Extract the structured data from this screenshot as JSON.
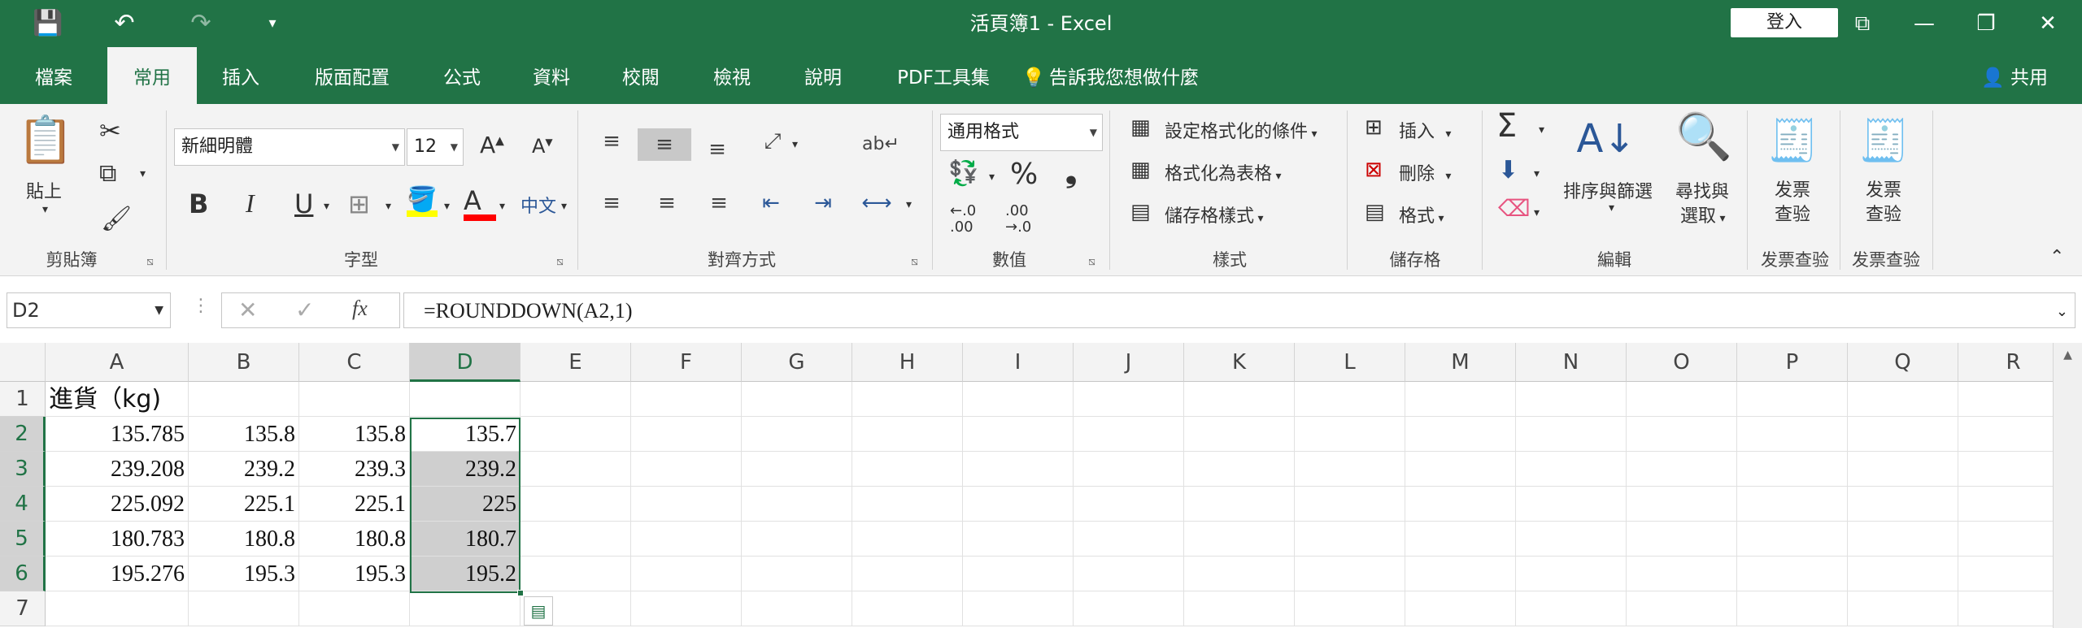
{
  "window": {
    "title": "活頁簿1  -  Excel",
    "login_label": "登入",
    "icons": {
      "save": "💾",
      "undo": "↶",
      "redo": "↷",
      "customize": "▾",
      "restore": "⧉",
      "minimize": "—",
      "maximize": "❐",
      "close": "✕"
    }
  },
  "tabs": [
    {
      "label": "檔案"
    },
    {
      "label": "常用"
    },
    {
      "label": "插入"
    },
    {
      "label": "版面配置"
    },
    {
      "label": "公式"
    },
    {
      "label": "資料"
    },
    {
      "label": "校閱"
    },
    {
      "label": "檢視"
    },
    {
      "label": "說明"
    },
    {
      "label": "PDF工具集"
    },
    {
      "label": "告訴我您想做什麼"
    }
  ],
  "active_tab": "常用",
  "share_label": "共用",
  "ribbon": {
    "clipboard": {
      "paste": "貼上",
      "group": "剪貼簿"
    },
    "font": {
      "name": "新細明體",
      "size": "12",
      "group": "字型",
      "bold": "B",
      "italic": "I",
      "underline": "U",
      "phonetic": "中文"
    },
    "alignment": {
      "group": "對齊方式"
    },
    "number": {
      "format": "通用格式",
      "percent": "%",
      "comma": "❟",
      "inc_decimal": "←.0\n.00",
      "dec_decimal": ".00\n→.0",
      "group": "數值"
    },
    "styles": {
      "conditional": "設定格式化的條件",
      "as_table": "格式化為表格",
      "cell_styles": "儲存格樣式",
      "group": "樣式"
    },
    "cells": {
      "insert": "插入",
      "delete": "刪除",
      "format": "格式",
      "group": "儲存格"
    },
    "editing": {
      "sort_filter": "排序與篩選",
      "find_select_1": "尋找與",
      "find_select_2": "選取",
      "group": "編輯"
    },
    "invoice1": {
      "label_1": "发票",
      "label_2": "查验",
      "group": "发票查验"
    },
    "invoice2": {
      "label_1": "发票",
      "label_2": "查验",
      "group": "发票查验"
    }
  },
  "formula_bar": {
    "name_box": "D2",
    "formula": "=ROUNDDOWN(A2,1)",
    "fx": "fx"
  },
  "columns": [
    "A",
    "B",
    "C",
    "D",
    "E",
    "F",
    "G",
    "H",
    "I",
    "J",
    "K",
    "L",
    "M",
    "N",
    "O",
    "P",
    "Q",
    "R"
  ],
  "rows": [
    "1",
    "2",
    "3",
    "4",
    "5",
    "6",
    "7"
  ],
  "cells": {
    "A1": "進貨（kg)",
    "A": [
      "135.785",
      "239.208",
      "225.092",
      "180.783",
      "195.276"
    ],
    "B": [
      "135.8",
      "239.2",
      "225.1",
      "180.8",
      "195.3"
    ],
    "C": [
      "135.8",
      "239.3",
      "225.1",
      "180.8",
      "195.3"
    ],
    "D": [
      "135.7",
      "239.2",
      "225",
      "180.7",
      "195.2"
    ]
  },
  "selection": {
    "active": "D2",
    "range": "D2:D6"
  },
  "colors": {
    "excel_green": "#217346",
    "ribbon_bg": "#f3f3f3",
    "selection_shade": "#cfcfcf"
  }
}
